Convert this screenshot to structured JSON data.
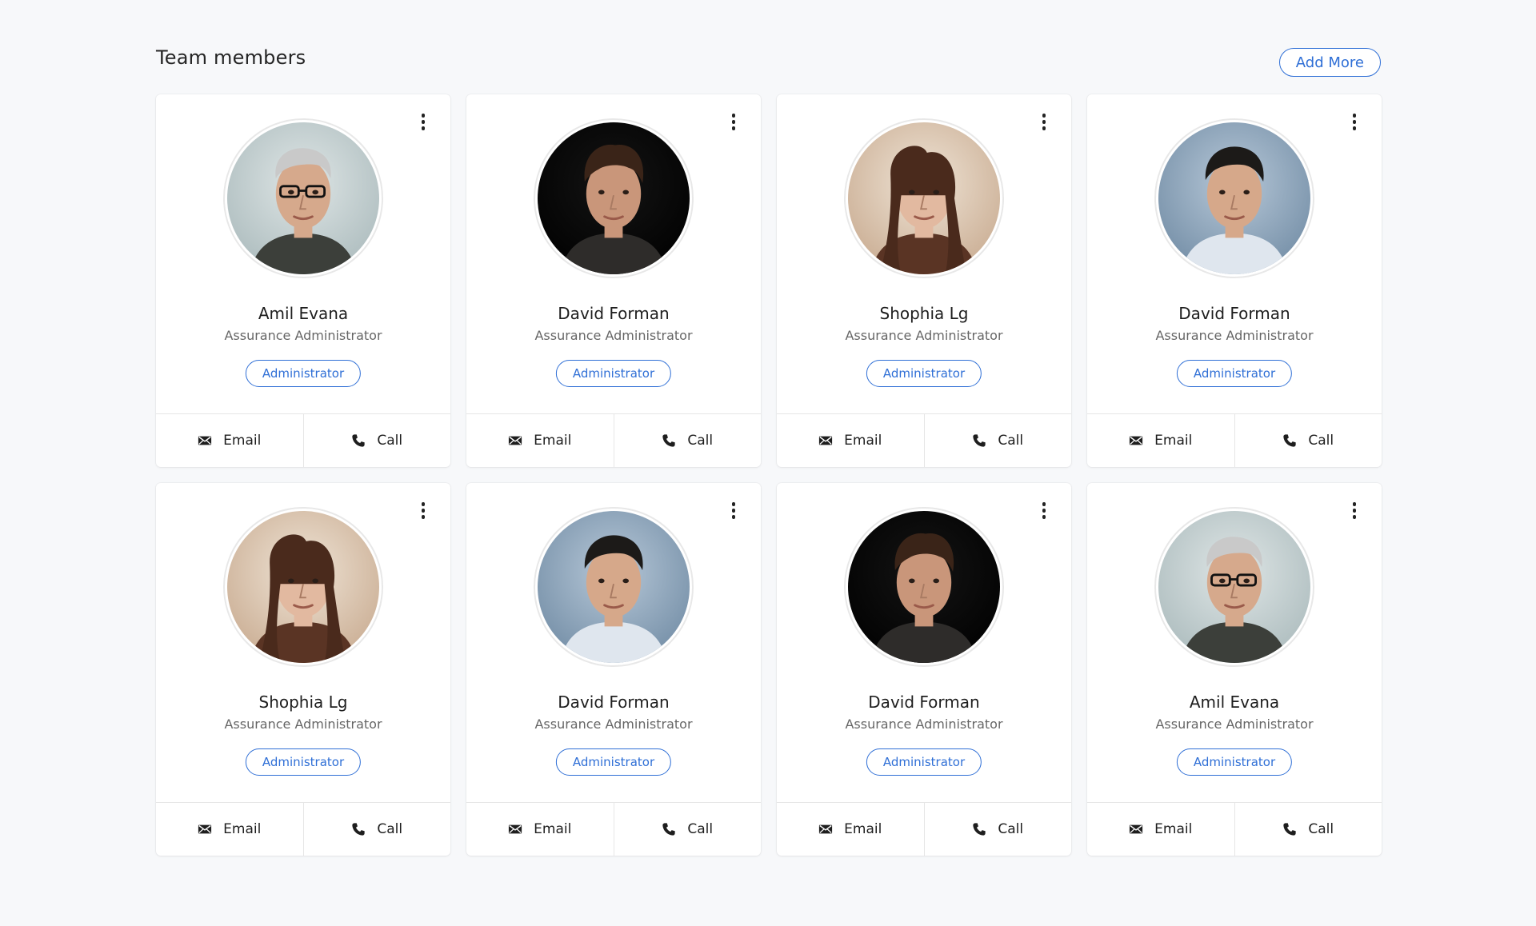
{
  "page": {
    "title": "Team members",
    "add_button": "Add More"
  },
  "colors": {
    "accent": "#2f6fd6",
    "background": "#f7f8fa",
    "card": "#ffffff"
  },
  "members": [
    {
      "name": "Amil Evana",
      "role": "Assurance Administrator",
      "badge": "Administrator",
      "email_label": "Email",
      "call_label": "Call",
      "avatar": "older-man-glasses"
    },
    {
      "name": "David Forman",
      "role": "Assurance Administrator",
      "badge": "Administrator",
      "email_label": "Email",
      "call_label": "Call",
      "avatar": "young-man-dark"
    },
    {
      "name": "Shophia Lg",
      "role": "Assurance Administrator",
      "badge": "Administrator",
      "email_label": "Email",
      "call_label": "Call",
      "avatar": "young-woman"
    },
    {
      "name": "David Forman",
      "role": "Assurance Administrator",
      "badge": "Administrator",
      "email_label": "Email",
      "call_label": "Call",
      "avatar": "man-blue-bg"
    },
    {
      "name": "Shophia Lg",
      "role": "Assurance Administrator",
      "badge": "Administrator",
      "email_label": "Email",
      "call_label": "Call",
      "avatar": "young-woman"
    },
    {
      "name": "David Forman",
      "role": "Assurance Administrator",
      "badge": "Administrator",
      "email_label": "Email",
      "call_label": "Call",
      "avatar": "man-blue-bg"
    },
    {
      "name": "David Forman",
      "role": "Assurance Administrator",
      "badge": "Administrator",
      "email_label": "Email",
      "call_label": "Call",
      "avatar": "young-man-dark"
    },
    {
      "name": "Amil Evana",
      "role": "Assurance Administrator",
      "badge": "Administrator",
      "email_label": "Email",
      "call_label": "Call",
      "avatar": "older-man-glasses"
    }
  ]
}
